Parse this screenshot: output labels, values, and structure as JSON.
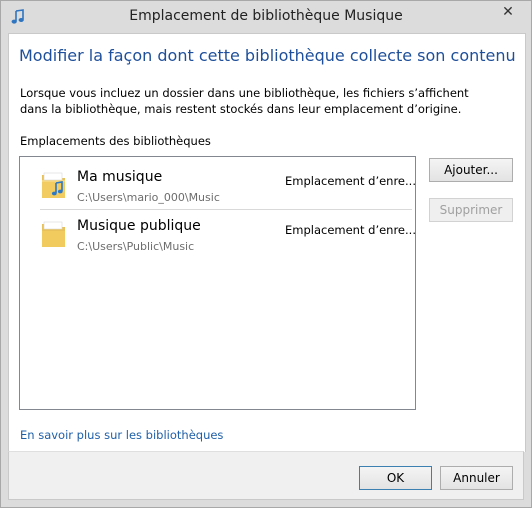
{
  "window": {
    "title": "Emplacement de bibliothèque Musique",
    "close_glyph": "✕",
    "title_icon": "music-note-icon"
  },
  "main": {
    "heading": "Modifier la façon dont cette bibliothèque collecte son contenu",
    "description": "Lorsque vous incluez un dossier dans une bibliothèque, les fichiers s’affichent dans la bibliothèque, mais restent stockés dans leur emplacement d’origine.",
    "section_label": "Emplacements des bibliothèques",
    "locations": [
      {
        "name": "Ma musique",
        "path": "C:\\Users\\mario_000\\Music",
        "type": "Emplacement d’enre...",
        "icon": "music-folder-icon"
      },
      {
        "name": "Musique publique",
        "path": "C:\\Users\\Public\\Music",
        "type": "Emplacement d’enre...",
        "icon": "folder-icon"
      }
    ],
    "add_label": "Ajouter...",
    "remove_label": "Supprimer",
    "learn_more": "En savoir plus sur les bibliothèques"
  },
  "footer": {
    "ok_label": "OK",
    "cancel_label": "Annuler"
  },
  "colors": {
    "heading": "#1e4f9a",
    "link": "#1e5fa8",
    "window_frame": "#dcdcdc"
  }
}
